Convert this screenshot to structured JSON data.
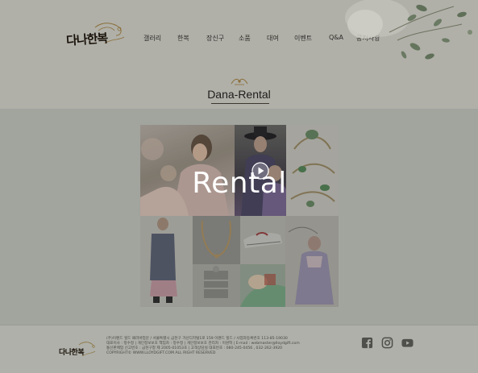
{
  "brand": {
    "logo_text": "다나한복"
  },
  "nav": {
    "items": [
      {
        "label": "갤러리",
        "name": "gallery"
      },
      {
        "label": "한복",
        "name": "hanbok"
      },
      {
        "label": "장신구",
        "name": "accessories"
      },
      {
        "label": "소품",
        "name": "props"
      },
      {
        "label": "대여",
        "name": "rental"
      },
      {
        "label": "이벤트",
        "name": "event"
      },
      {
        "label": "Q&A",
        "name": "qna"
      },
      {
        "label": "공지사항",
        "name": "notice"
      }
    ]
  },
  "section": {
    "title": "Dana-Rental"
  },
  "gallery": {
    "overlay_label": "Rental"
  },
  "footer": {
    "logo_text": "다나한복",
    "lines": [
      "(주)이랜드 힐드 패러바업문 / 서울특별시 금천구 가산디지털1로 159 이랜드 힐드 / 사업자등록번호 113-85-19030",
      "대표이사 : 정수정 | 개인정보보호 책임자 : 정수정 | 개인정보보호 관리자 : 이원혁 | E-mail : webmaster@lloydgift.com",
      "통신판매업 신고번호 : 금천구청 제 2005-01053호 | 고객상담실 대표번호 : 080-245-0456 , 032-262-3920",
      "COPYRIGHT© WWW.LLOYDGIFT.COM ALL RIGHT RESERVED"
    ]
  },
  "social": [
    {
      "name": "facebook-icon"
    },
    {
      "name": "instagram-icon"
    },
    {
      "name": "youtube-icon"
    }
  ]
}
